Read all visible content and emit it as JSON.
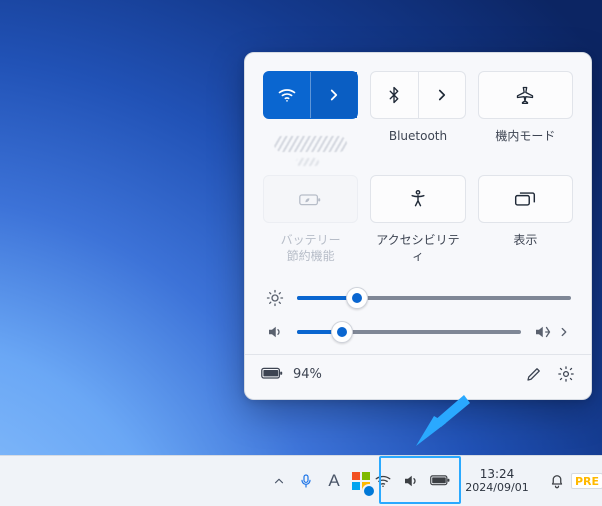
{
  "panel": {
    "tiles": {
      "wifi": {
        "expandable": true,
        "active": true
      },
      "bluetooth": {
        "label": "Bluetooth",
        "expandable": true
      },
      "airplane": {
        "label": "機内モード"
      },
      "battery": {
        "label": "バッテリー\n節約機能",
        "disabled": true
      },
      "accessibility": {
        "label": "アクセシビリティ"
      },
      "project": {
        "label": "表示"
      }
    },
    "sliders": {
      "brightness": {
        "percent": 22
      },
      "volume": {
        "percent": 20
      }
    },
    "footer": {
      "battery_pct_label": "94%"
    }
  },
  "taskbar": {
    "time": "13:24",
    "date": "2024/09/01",
    "pre_badge": "PRE"
  }
}
